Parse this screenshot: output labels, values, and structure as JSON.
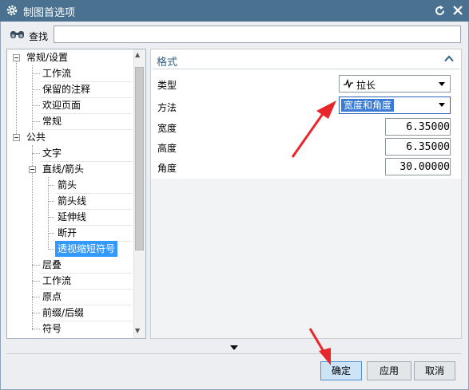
{
  "window": {
    "title": "制图首选项"
  },
  "search": {
    "label": "查找",
    "value": ""
  },
  "tree": {
    "items": [
      {
        "label": "常规/设置"
      },
      {
        "label": "工作流"
      },
      {
        "label": "保留的注释"
      },
      {
        "label": "欢迎页面"
      },
      {
        "label": "常规"
      },
      {
        "label": "公共"
      },
      {
        "label": "文字"
      },
      {
        "label": "直线/箭头"
      },
      {
        "label": "箭头"
      },
      {
        "label": "箭头线"
      },
      {
        "label": "延伸线"
      },
      {
        "label": "断开"
      },
      {
        "label": "透视缩短符号",
        "selected": true
      },
      {
        "label": "层叠"
      },
      {
        "label": "工作流"
      },
      {
        "label": "原点"
      },
      {
        "label": "前缀/后缀"
      },
      {
        "label": "符号"
      }
    ]
  },
  "format_group": {
    "title": "格式",
    "type_label": "类型",
    "type_value": "拉长",
    "type_icon": "zigzag-line-icon",
    "method_label": "方法",
    "method_value": "宽度和角度",
    "width_label": "宽度",
    "width_value": "6.35000",
    "height_label": "高度",
    "height_value": "6.35000",
    "angle_label": "角度",
    "angle_value": "30.00000"
  },
  "buttons": {
    "ok": "确定",
    "apply": "应用",
    "cancel": "取消"
  },
  "colors": {
    "titlebar": "#4a7290",
    "selection": "#3399ff",
    "group_title": "#2f5f87",
    "annotation_arrow": "#e8262a"
  }
}
